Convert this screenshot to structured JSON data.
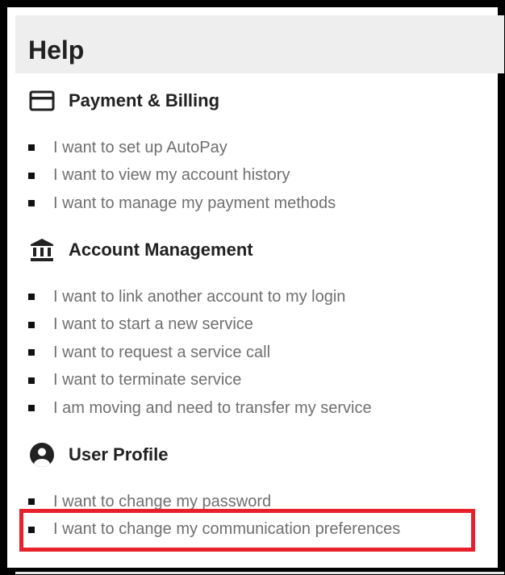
{
  "help": {
    "title": "Help"
  },
  "sections": [
    {
      "title": "Payment & Billing",
      "icon": "credit-card-icon",
      "links": [
        "I want to set up AutoPay",
        "I want to view my account history",
        "I want to manage my payment methods"
      ]
    },
    {
      "title": "Account Management",
      "icon": "bank-icon",
      "links": [
        "I want to link another account to my login",
        "I want to start a new service",
        "I want to request a service call",
        "I want to terminate service",
        "I am moving and need to transfer my service"
      ]
    },
    {
      "title": "User Profile",
      "icon": "account-circle-icon",
      "links": [
        "I want to change my password",
        "I want to change my communication preferences"
      ]
    }
  ],
  "colors": {
    "frame_border": "#000000",
    "header_bg": "#eeeeee",
    "link_text": "#6f6f6f",
    "highlight_border": "#e8202a"
  }
}
